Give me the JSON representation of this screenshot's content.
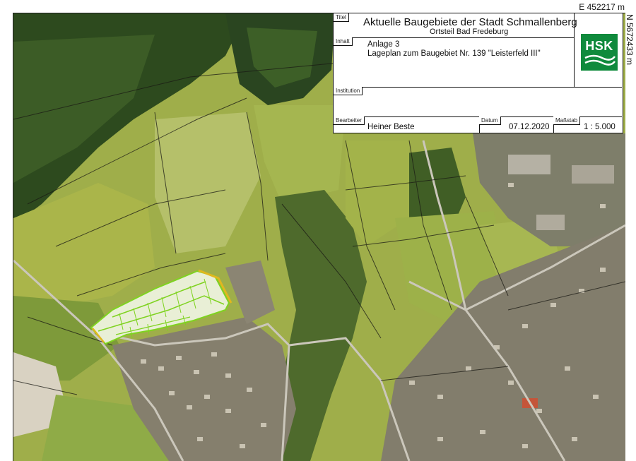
{
  "coords": {
    "easting": "E 452217 m",
    "northing": "N 5672433 m"
  },
  "title_block": {
    "titel_tag": "Titel",
    "title": "Aktuelle Baugebiete der Stadt Schmallenberg",
    "subtitle": "Ortsteil Bad Fredeburg",
    "inhalt_tag": "Inhalt",
    "content_line1": "Anlage 3",
    "content_line2": "Lageplan zum Baugebiet Nr. 139 \"Leisterfeld III\"",
    "institution_tag": "Institution",
    "institution": "",
    "bearbeiter_tag": "Bearbeiter",
    "bearbeiter": "Heiner Beste",
    "datum_tag": "Datum",
    "datum": "07.12.2020",
    "massstab_tag": "Maßstab",
    "massstab": "1 : 5.000",
    "logo_text": "HSK"
  },
  "colors": {
    "forest": "#2f4a1f",
    "meadow": "#a7b84e",
    "field": "#b9c066",
    "settlement": "#8a8676",
    "road": "#c9c6bb",
    "plan_outline": "#7fd320",
    "plan_access": "#e0b81e",
    "logo_green": "#0f8a3c"
  }
}
